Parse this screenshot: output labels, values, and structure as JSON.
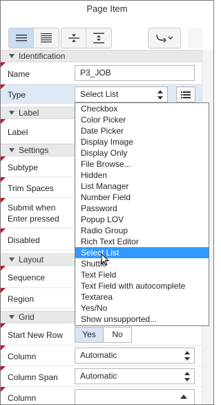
{
  "title": "Page Item",
  "toolbar": {
    "buttons": [
      {
        "name": "show-common-icon"
      },
      {
        "name": "show-all-icon"
      },
      {
        "name": "collapse-all-icon"
      },
      {
        "name": "expand-all-icon"
      },
      {
        "name": "go-to-group-icon"
      }
    ]
  },
  "sections": {
    "identification": "Identification",
    "label": "Label",
    "settings": "Settings",
    "layout": "Layout",
    "grid": "Grid"
  },
  "properties": {
    "name": {
      "label": "Name",
      "value": "P3_JOB"
    },
    "type": {
      "label": "Type",
      "value": "Select List"
    },
    "label": {
      "label": "Label"
    },
    "subtype": {
      "label": "Subtype"
    },
    "trim_spaces": {
      "label": "Trim Spaces"
    },
    "submit_enter": {
      "label_line1": "Submit when",
      "label_line2": "Enter pressed"
    },
    "disabled": {
      "label": "Disabled"
    },
    "sequence": {
      "label": "Sequence"
    },
    "region": {
      "label": "Region"
    },
    "start_new_row": {
      "label": "Start New Row",
      "yes": "Yes",
      "no": "No",
      "selected": "Yes"
    },
    "column": {
      "label": "Column",
      "value": "Automatic"
    },
    "column_span": {
      "label": "Column Span",
      "value": "Automatic"
    },
    "column2": {
      "label": "Column"
    }
  },
  "dropdown": {
    "selected": "Select List",
    "options": [
      "Checkbox",
      "Color Picker",
      "Date Picker",
      "Display Image",
      "Display Only",
      "File Browse...",
      "Hidden",
      "List Manager",
      "Number Field",
      "Password",
      "Popup LOV",
      "Radio Group",
      "Rich Text Editor",
      "Select List",
      "Shuttle",
      "Text Field",
      "Text Field with autocomplete",
      "Textarea",
      "Yes/No",
      "Show unsupported..."
    ]
  },
  "colors": {
    "accent": "#3399ff",
    "section_bg": "#e8e8e8",
    "required_marker": "#c8102e",
    "active_button": "#c9dcf2"
  }
}
